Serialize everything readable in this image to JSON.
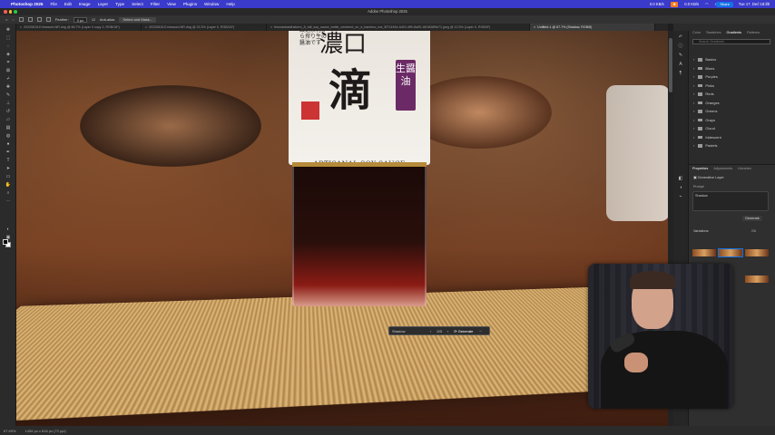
{
  "menubar": {
    "app": "Photoshop 2025",
    "items": [
      "File",
      "Edit",
      "Image",
      "Layer",
      "Type",
      "Select",
      "Filter",
      "View",
      "Plugins",
      "Window",
      "Help"
    ],
    "status": [
      "0.0 KB/s",
      "0.0 KB/s",
      "41 %",
      "Tue 17. Dec 18:28"
    ]
  },
  "window": {
    "title": "Adobe Photoshop 2025"
  },
  "options": {
    "feather_label": "Feather:",
    "feather_value": "0 px",
    "anti_alias": "Anti-alias",
    "select_mask": "Select and Mask...",
    "share": "Share"
  },
  "tabs": [
    {
      "label": "20220815-Enhanced-NR.dng @ 66.7% (Layer 0 copy 2, RGB/16*)",
      "active": false
    },
    {
      "label": "20220815-Enhanced-NR.dng @ 33.3% (Layer 0, RGB/16*)",
      "active": false
    },
    {
      "label": "thomasbastinstorm_A_tall_soy_sauce_bottle_centered_on_a_bamboo_ma_5f71449d-4d19-4ff9-8a05-16f1608f9e71.jpeg @ 12.5% (Layer 0, RGB/8*)",
      "active": false
    },
    {
      "label": "Untitled-1 @ 67.7% (Shadow, RGB/8)",
      "active": true
    }
  ],
  "bottle": {
    "kanji_main": "滴",
    "kanji_top": "濃口",
    "tag": "生醤油",
    "vertical_text": "厳選素材から搾り生の醤油です",
    "brand": "ARTISANAL SOY SAUCE"
  },
  "taskbar": {
    "prompt": "Shadow",
    "counter": "2/3",
    "generate": "Generate"
  },
  "status": {
    "zoom": "67.69%",
    "size": "1456 px x 816 px (72 ppi)"
  },
  "right_panel": {
    "top_tabs": [
      "Color",
      "Swatches",
      "Gradients",
      "Patterns"
    ],
    "active_top": "Gradients",
    "search_placeholder": "Search Gradients",
    "gradient_folders": [
      "Basics",
      "Blues",
      "Purples",
      "Pinks",
      "Reds",
      "Oranges",
      "Greens",
      "Grays",
      "Cloud",
      "Iridescent",
      "Pastels"
    ],
    "props_tabs": [
      "Properties",
      "Adjustments",
      "Libraries"
    ],
    "active_props": "Properties",
    "layer_type": "Generative Layer",
    "prompt_label": "Prompt",
    "prompt_value": "Shadow",
    "generate": "Generate",
    "variations_label": "Variations",
    "variations_count": "2/6"
  }
}
